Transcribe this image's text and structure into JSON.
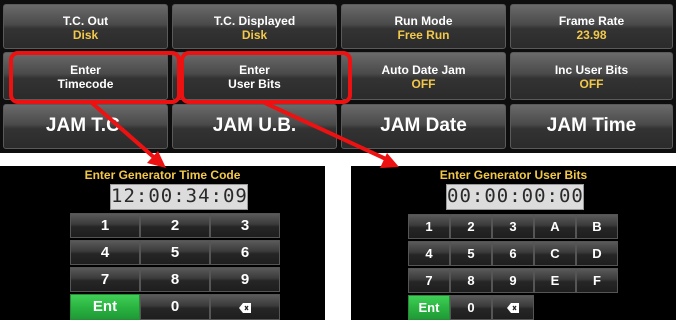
{
  "top_buttons": {
    "tc_out": {
      "label": "T.C. Out",
      "value": "Disk"
    },
    "tc_displayed": {
      "label": "T.C. Displayed",
      "value": "Disk"
    },
    "run_mode": {
      "label": "Run Mode",
      "value": "Free Run"
    },
    "frame_rate": {
      "label": "Frame Rate",
      "value": "23.98"
    },
    "enter_timecode": {
      "line1": "Enter",
      "line2": "Timecode"
    },
    "enter_user_bits": {
      "line1": "Enter",
      "line2": "User Bits"
    },
    "auto_date_jam": {
      "label": "Auto Date Jam",
      "value": "OFF"
    },
    "inc_user_bits": {
      "label": "Inc User Bits",
      "value": "OFF"
    },
    "jam_tc": "JAM T.C.",
    "jam_ub": "JAM U.B.",
    "jam_date": "JAM Date",
    "jam_time": "JAM Time"
  },
  "timecode_pad": {
    "title": "Enter Generator Time Code",
    "display": "12:00:34:09",
    "keys": [
      "1",
      "2",
      "3",
      "4",
      "5",
      "6",
      "7",
      "8",
      "9"
    ],
    "enter": "Ent",
    "zero": "0",
    "backspace_icon": "backspace-icon"
  },
  "userbits_pad": {
    "title": "Enter Generator User Bits",
    "display": "00:00:00:00",
    "keys": [
      "1",
      "2",
      "3",
      "A",
      "B",
      "4",
      "5",
      "6",
      "C",
      "D",
      "7",
      "8",
      "9",
      "E",
      "F"
    ],
    "enter": "Ent",
    "zero": "0",
    "backspace_icon": "backspace-icon"
  },
  "colors": {
    "highlight": "#ee1111",
    "accent_yellow": "#f2c84b",
    "enter_green": "#2bb442"
  }
}
